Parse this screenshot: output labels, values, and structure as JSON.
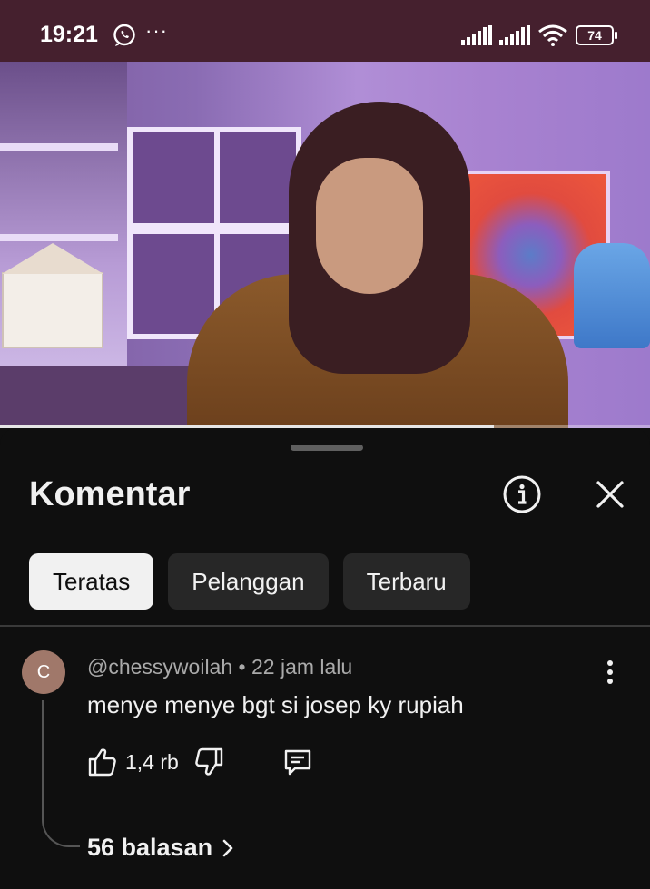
{
  "status_bar": {
    "time": "19:21",
    "dots": "···",
    "battery": "74",
    "icons": [
      "whatsapp-icon",
      "signal-icon",
      "signal-icon",
      "wifi-icon",
      "battery-icon"
    ]
  },
  "video": {
    "progress_fraction": 0.76
  },
  "comments_panel": {
    "title": "Komentar",
    "info_icon": "info-icon",
    "close_icon": "close-icon",
    "chips": [
      {
        "label": "Teratas",
        "active": true
      },
      {
        "label": "Pelanggan",
        "active": false
      },
      {
        "label": "Terbaru",
        "active": false
      }
    ]
  },
  "comment": {
    "avatar_letter": "C",
    "author": "@chessywoilah",
    "separator": "•",
    "time": "22 jam lalu",
    "text": "menye menye bgt si josep ky rupiah",
    "likes": "1,4 rb",
    "replies_label": "56 balasan",
    "icons": [
      "like-icon",
      "dislike-icon",
      "reply-icon",
      "more-vert-icon",
      "chevron-right-icon"
    ]
  },
  "colors": {
    "status_bar_bg": "#45202e",
    "sheet_bg": "#0f0f0f",
    "chip_active_bg": "#f1f1f1",
    "chip_bg": "#272727",
    "avatar_bg": "#a0786a"
  }
}
